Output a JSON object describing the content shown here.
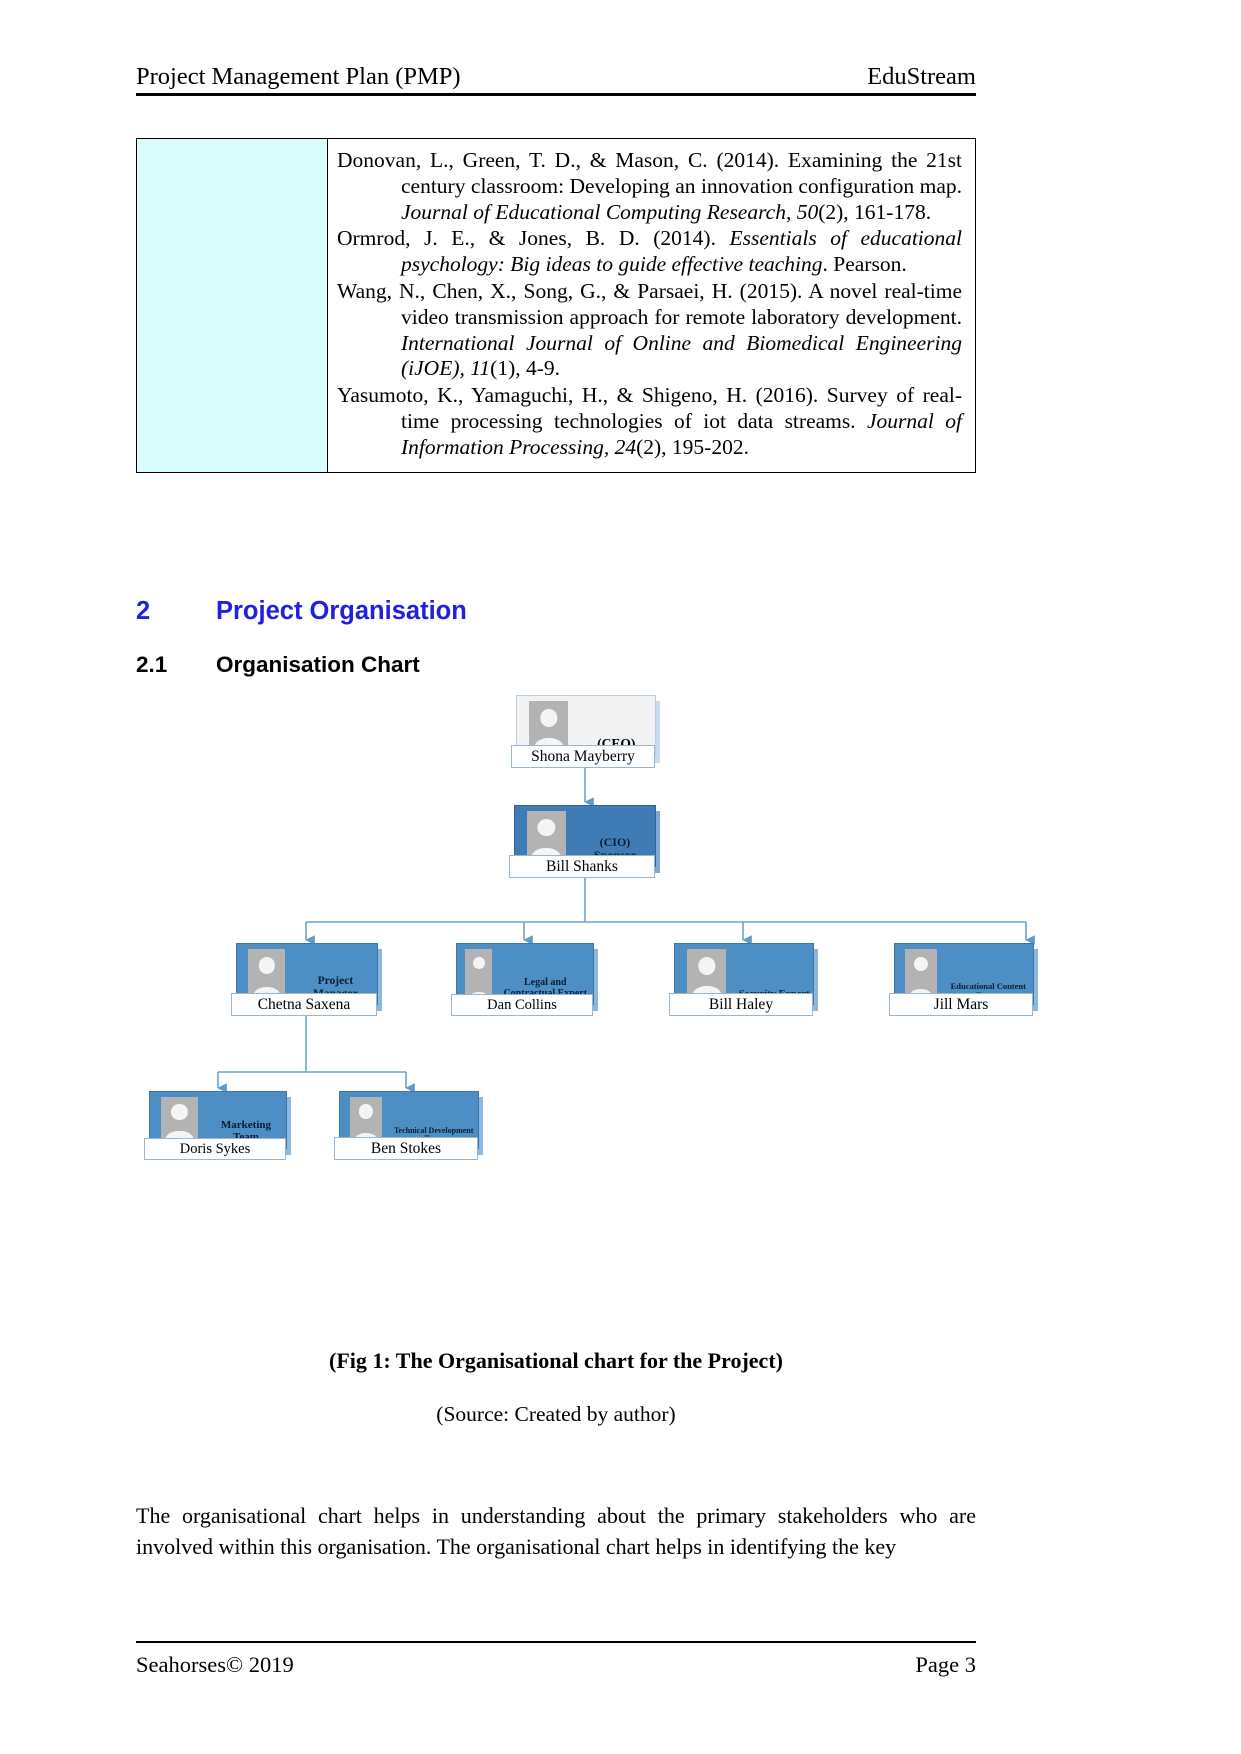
{
  "header": {
    "left": "Project Management Plan (PMP)",
    "right": "EduStream"
  },
  "references_table": {
    "left_cell_color": "#d9fdfd",
    "entries": [
      {
        "parts": [
          {
            "text": "Donovan, L., Green, T. D., & Mason, C. (2014). Examining the 21st century classroom: Developing an innovation configuration map. ",
            "italic": false
          },
          {
            "text": "Journal of Educational Computing Research",
            "italic": true
          },
          {
            "text": ", ",
            "italic": false
          },
          {
            "text": "50",
            "italic": true
          },
          {
            "text": "(2), 161-178.",
            "italic": false
          }
        ]
      },
      {
        "parts": [
          {
            "text": "Ormrod, J. E., & Jones, B. D. (2014). ",
            "italic": false
          },
          {
            "text": "Essentials of educational psychology: Big ideas to guide effective teaching",
            "italic": true
          },
          {
            "text": ". Pearson.",
            "italic": false
          }
        ]
      },
      {
        "parts": [
          {
            "text": "Wang, N., Chen, X., Song, G., & Parsaei, H. (2015). A novel real-time video transmission approach for remote laboratory development. ",
            "italic": false
          },
          {
            "text": "International Journal of Online and Biomedical Engineering (iJOE), 11",
            "italic": true
          },
          {
            "text": "(1), 4-9.",
            "italic": false
          }
        ]
      },
      {
        "parts": [
          {
            "text": "Yasumoto, K., Yamaguchi, H., & Shigeno, H. (2016). Survey of real-time processing technologies of iot data streams. ",
            "italic": false
          },
          {
            "text": "Journal of Information Processing, 24",
            "italic": true
          },
          {
            "text": "(2), 195-202.",
            "italic": false
          }
        ]
      }
    ]
  },
  "headings": {
    "section_number": "2",
    "section_title": "Project Organisation",
    "section_color": "#2020e0",
    "subsection_number": "2.1",
    "subsection_title": "Organisation Chart"
  },
  "org_chart": {
    "nodes": [
      {
        "id": "ceo",
        "role": "(CEO)",
        "name": "Shona Mayberry",
        "style": "light"
      },
      {
        "id": "cio",
        "role": "(CIO) Sponsor",
        "name": "Bill Shanks",
        "style": "blue"
      },
      {
        "id": "pm",
        "role": "Project Manager",
        "name": "Chetna Saxena",
        "style": "mid"
      },
      {
        "id": "legal",
        "role": "Legal and Contractual Expert",
        "name": "Dan Collins",
        "style": "mid"
      },
      {
        "id": "sec",
        "role": "Security Expert",
        "name": "Bill Haley",
        "style": "mid"
      },
      {
        "id": "content",
        "role": "Educational Content Expert",
        "name": "Jill Mars",
        "style": "mid"
      },
      {
        "id": "mkt",
        "role": "Marketing Team",
        "name": "Doris Sykes",
        "style": "mid"
      },
      {
        "id": "tech",
        "role": "Technical Development Team",
        "name": "Ben Stokes",
        "style": "mid"
      }
    ],
    "connector_color": "#6ba3d0"
  },
  "figure": {
    "caption": "(Fig 1: The Organisational chart for the Project)",
    "source": "(Source: Created by author)"
  },
  "body": {
    "paragraph": "The organisational chart helps in understanding about the primary stakeholders who are involved within this organisation. The organisational chart helps in identifying the key"
  },
  "footer": {
    "left": "Seahorses© 2019",
    "right": "Page 3"
  }
}
